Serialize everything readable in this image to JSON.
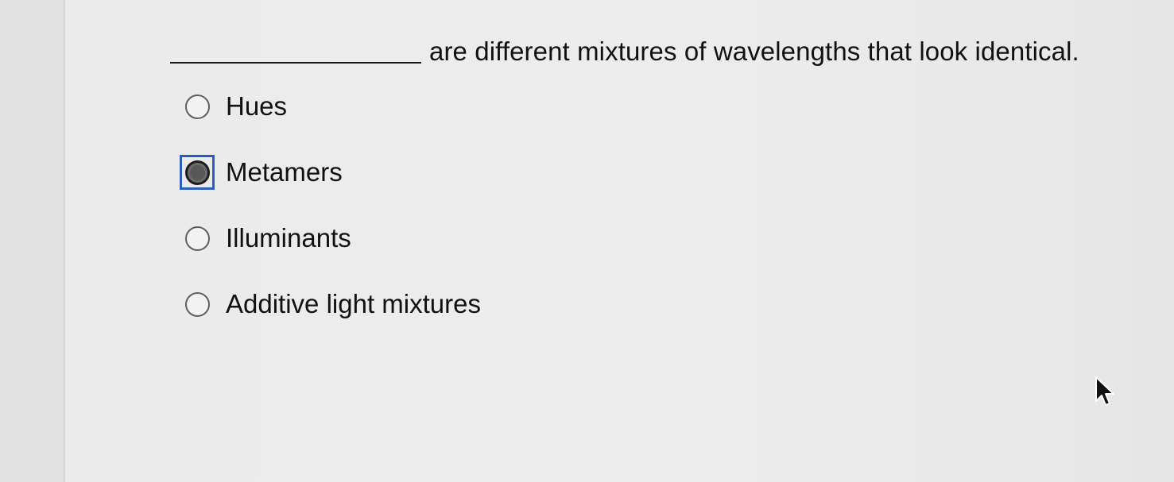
{
  "question": {
    "text": "are different mixtures of wavelengths that look identical."
  },
  "options": [
    {
      "label": "Hues",
      "selected": false
    },
    {
      "label": "Metamers",
      "selected": true
    },
    {
      "label": "Illuminants",
      "selected": false
    },
    {
      "label": "Additive light mixtures",
      "selected": false
    }
  ],
  "colors": {
    "focus_ring": "#2a5fb7",
    "text": "#111111"
  },
  "icons": {
    "cursor": "mouse-pointer-icon"
  }
}
